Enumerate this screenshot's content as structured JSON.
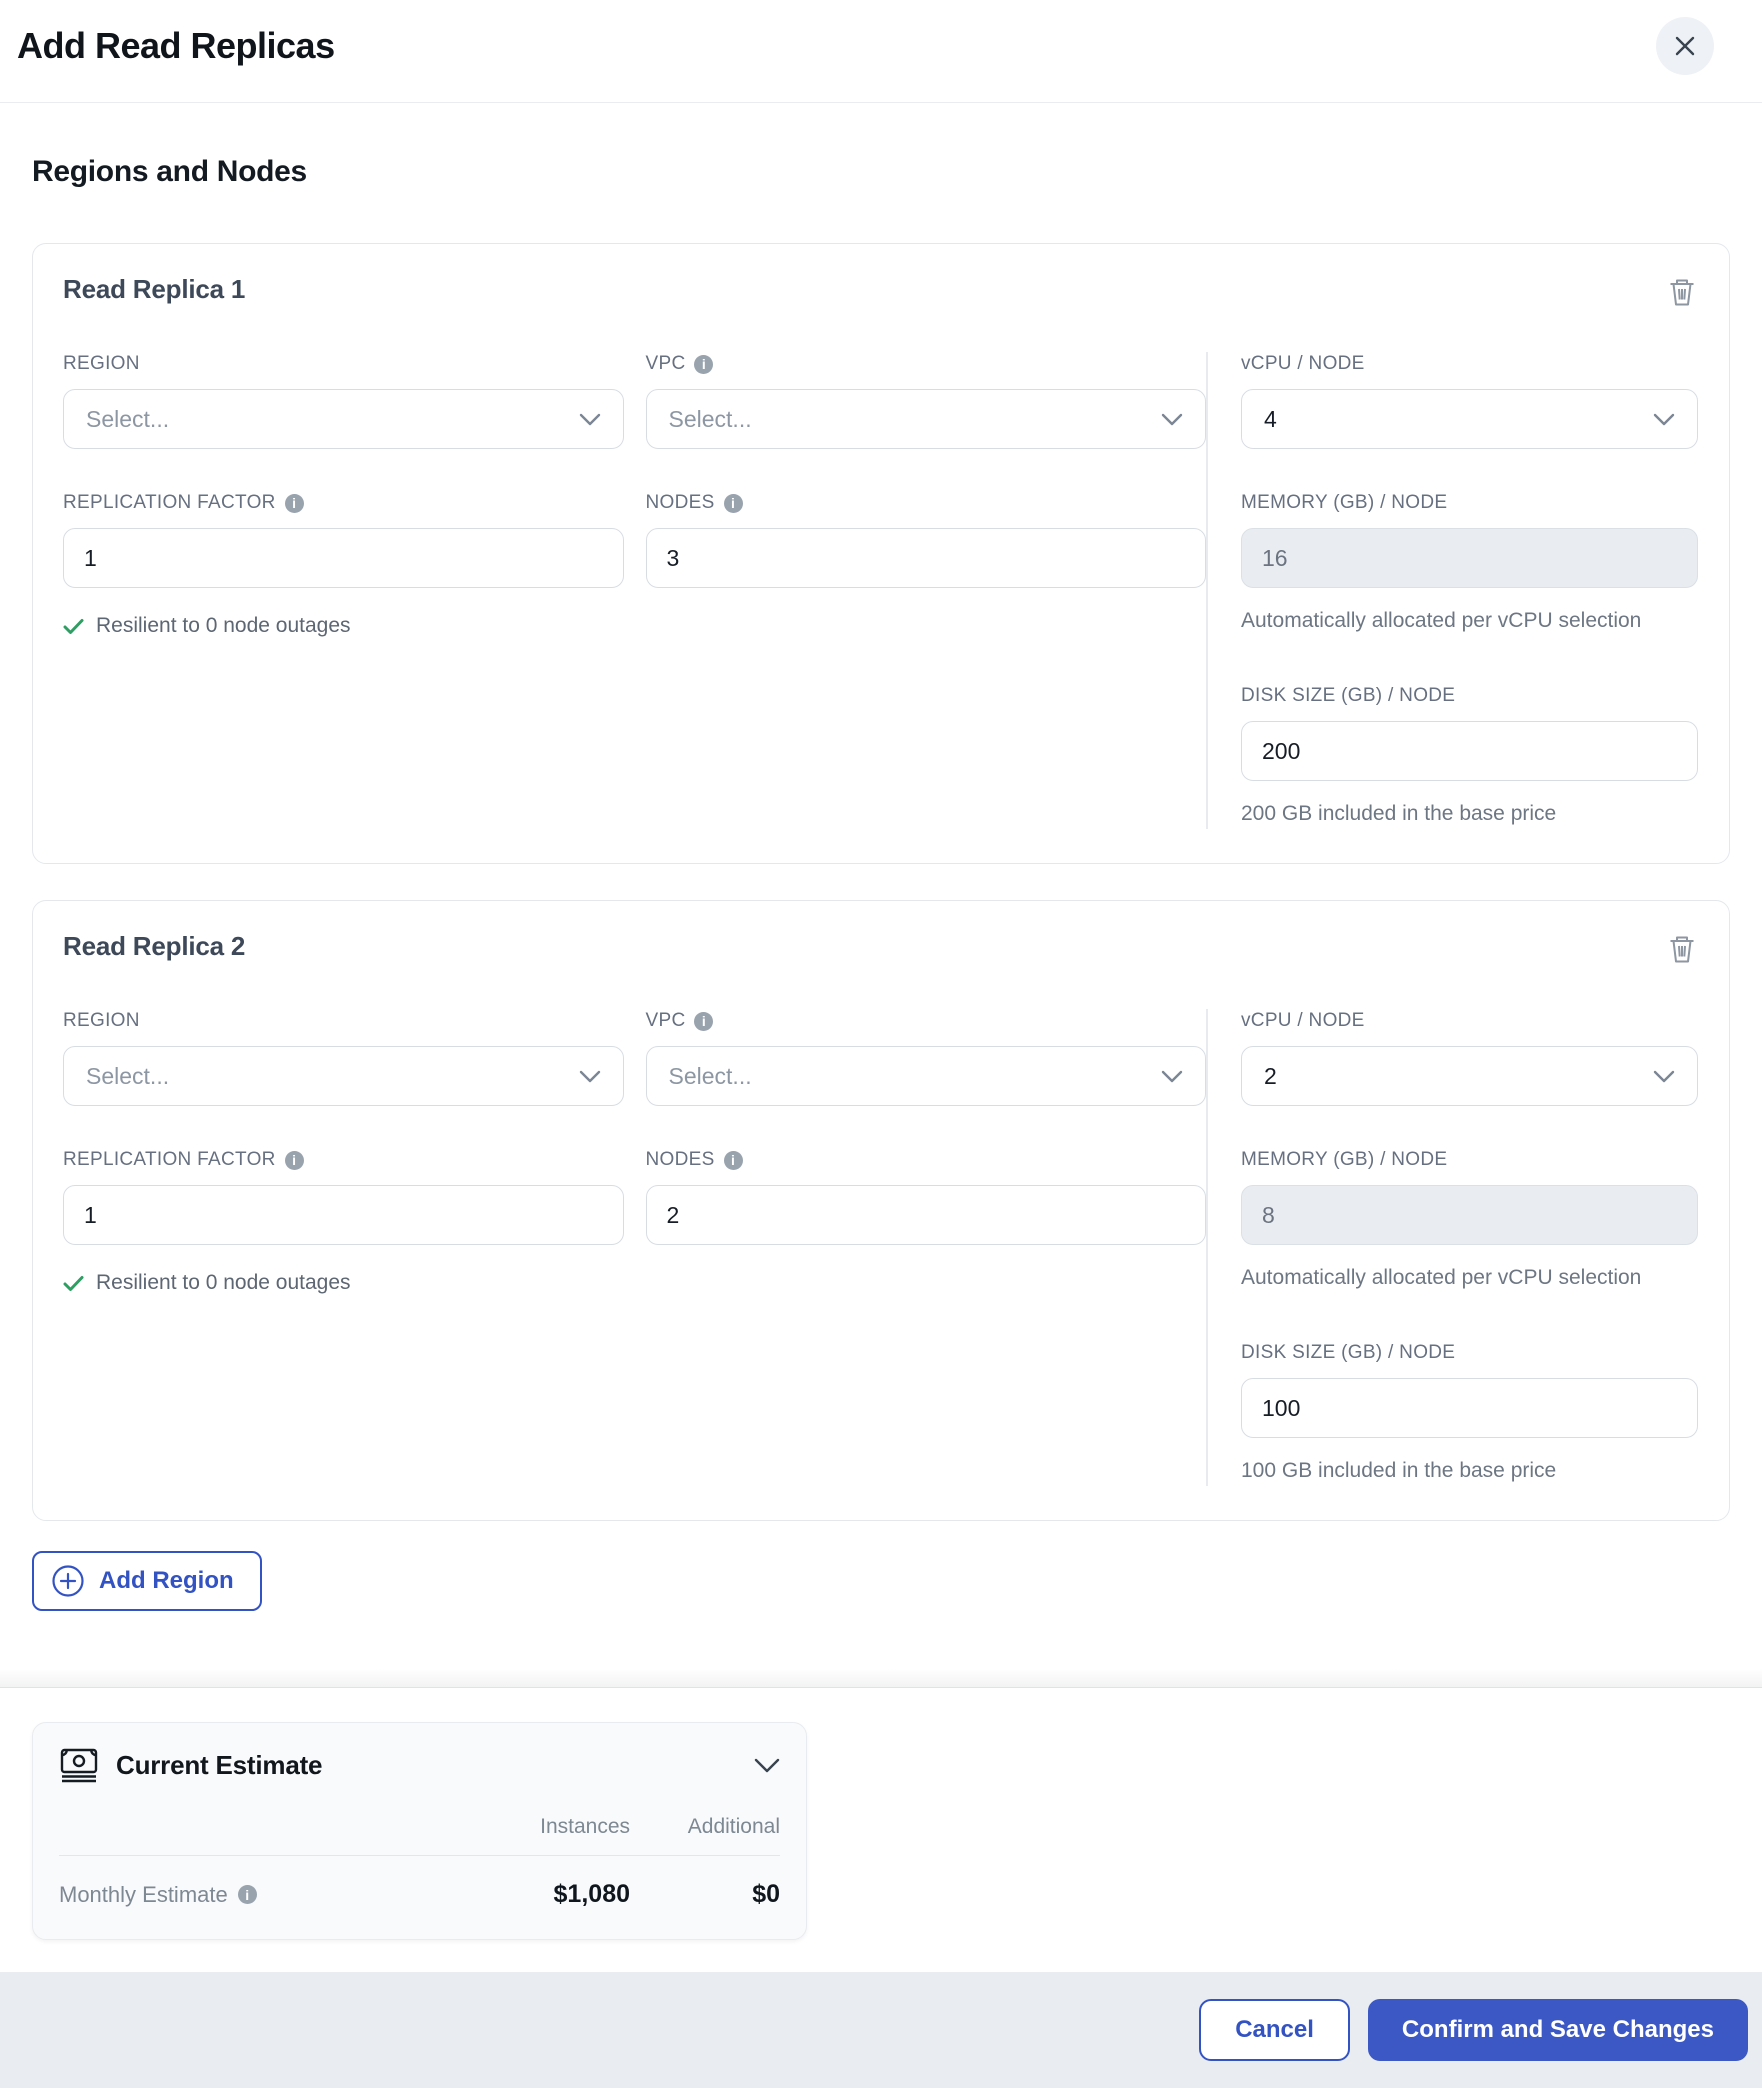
{
  "modal": {
    "title": "Add Read Replicas",
    "section_title": "Regions and Nodes"
  },
  "replicas": [
    {
      "title": "Read Replica 1",
      "region_label": "REGION",
      "region_placeholder": "Select...",
      "vpc_label": "VPC",
      "vpc_placeholder": "Select...",
      "replication_label": "REPLICATION FACTOR",
      "replication_value": "1",
      "nodes_label": "NODES",
      "nodes_value": "3",
      "resilience_text": "Resilient to 0 node outages",
      "vcpu_label": "vCPU / NODE",
      "vcpu_value": "4",
      "memory_label": "MEMORY (GB) / NODE",
      "memory_value": "16",
      "memory_note": "Automatically allocated per vCPU selection",
      "disk_label": "DISK SIZE (GB) / NODE",
      "disk_value": "200",
      "disk_note": "200 GB included in the base price"
    },
    {
      "title": "Read Replica 2",
      "region_label": "REGION",
      "region_placeholder": "Select...",
      "vpc_label": "VPC",
      "vpc_placeholder": "Select...",
      "replication_label": "REPLICATION FACTOR",
      "replication_value": "1",
      "nodes_label": "NODES",
      "nodes_value": "2",
      "resilience_text": "Resilient to 0 node outages",
      "vcpu_label": "vCPU / NODE",
      "vcpu_value": "2",
      "memory_label": "MEMORY (GB) / NODE",
      "memory_value": "8",
      "memory_note": "Automatically allocated per vCPU selection",
      "disk_label": "DISK SIZE (GB) / NODE",
      "disk_value": "100",
      "disk_note": "100 GB included in the base price"
    }
  ],
  "add_region": {
    "label": "Add Region"
  },
  "estimate": {
    "title": "Current Estimate",
    "columns": [
      "Instances",
      "Additional"
    ],
    "rows": [
      {
        "label": "Monthly Estimate",
        "instances": "$1,080",
        "additional": "$0"
      }
    ]
  },
  "footer": {
    "cancel_label": "Cancel",
    "confirm_label": "Confirm and Save Changes"
  },
  "colors": {
    "accent_blue": "#3c58c4",
    "success_green": "#2f9e63",
    "footer_background": "#e9ecf1"
  }
}
